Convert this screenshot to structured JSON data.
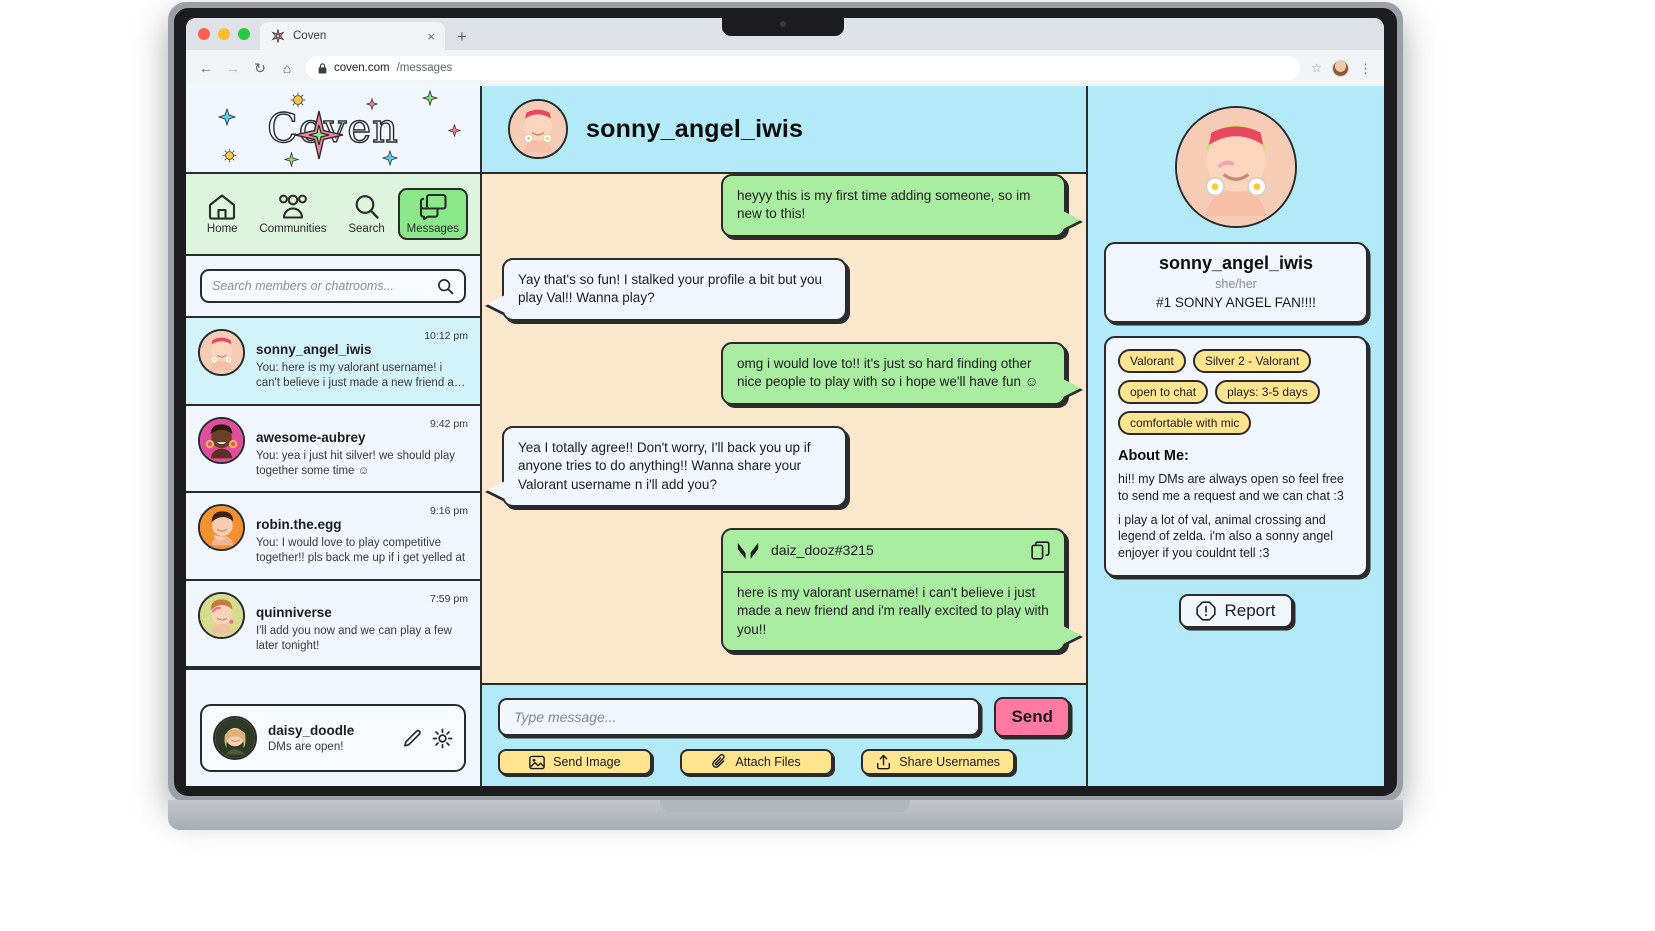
{
  "browser": {
    "tab": {
      "title": "Coven",
      "favicon": "star-sparkle-icon",
      "close": "×"
    },
    "newtab_label": "+",
    "nav": {
      "back": "←",
      "forward": "→",
      "reload": "↻",
      "home": "⌂"
    },
    "url": {
      "lock": "🔒",
      "host": "coven.com",
      "path": "/messages"
    },
    "actions": {
      "star": "☆",
      "menu": "⋮"
    }
  },
  "sidebar": {
    "logo": "Coven",
    "nav": [
      {
        "label": "Home",
        "icon": "home-icon",
        "active": false
      },
      {
        "label": "Communities",
        "icon": "people-group-icon",
        "active": false
      },
      {
        "label": "Search",
        "icon": "magnifier-icon",
        "active": false
      },
      {
        "label": "Messages",
        "icon": "chat-bubbles-icon",
        "active": true
      }
    ],
    "search": {
      "placeholder": "Search members or chatrooms...",
      "value": "",
      "icon": "search-icon"
    },
    "conversations": [
      {
        "name": "sonny_angel_iwis",
        "time": "10:12 pm",
        "preview": "You: here is my valorant username! i can't believe i just made a new friend and i'm...",
        "active": true
      },
      {
        "name": "awesome-aubrey",
        "time": "9:42 pm",
        "preview": "You: yea i just hit silver! we should play together some time ☺",
        "active": false
      },
      {
        "name": "robin.the.egg",
        "time": "9:16 pm",
        "preview": "You: I would love to play competitive together!! pls back me up if i get yelled at",
        "active": false
      },
      {
        "name": "quinniverse",
        "time": "7:59 pm",
        "preview": "I'll add you now and we can play a few later tonight!",
        "active": false
      }
    ],
    "me": {
      "name": "daisy_doodle",
      "status": "DMs are open!",
      "edit_icon": "pencil-icon",
      "settings_icon": "gear-icon"
    }
  },
  "chat": {
    "header_name": "sonny_angel_iwis",
    "messages": [
      {
        "side": "out",
        "text": "heyyy this is my first time adding someone, so im new to this!",
        "type": "text"
      },
      {
        "side": "in",
        "text": "Yay that's so fun! I stalked your profile a bit but you play Val!! Wanna play?",
        "type": "text"
      },
      {
        "side": "out",
        "text": "omg i would love to!! it's just so hard finding other nice people to play with so i hope we'll have fun ☺",
        "type": "text"
      },
      {
        "side": "in",
        "text": "Yea I totally agree!! Don't worry, I'll back you up if anyone tries to do anything!! Wanna share your Valorant username n i'll add you?",
        "type": "text"
      },
      {
        "side": "out",
        "type": "username-card",
        "game_icon": "valorant-icon",
        "username": "daiz_dooz#3215",
        "copy_icon": "copy-icon",
        "text": "here is my valorant username! i can't believe i just made a new friend and i'm really excited to play with you!!"
      }
    ],
    "composer": {
      "placeholder": "Type message...",
      "value": "",
      "send_label": "Send",
      "tools": [
        {
          "label": "Send Image",
          "icon": "image-icon"
        },
        {
          "label": "Attach Files",
          "icon": "paperclip-icon"
        },
        {
          "label": "Share Usernames",
          "icon": "share-upload-icon"
        }
      ]
    }
  },
  "profile": {
    "avatar": "profile-photo",
    "name": "sonny_angel_iwis",
    "pronouns": "she/her",
    "tagline": "#1 SONNY ANGEL FAN!!!!",
    "chips": [
      "Valorant",
      "Silver 2 - Valorant",
      "open to chat",
      "plays: 3-5 days",
      "comfortable with mic"
    ],
    "about_heading": "About Me:",
    "about_p1": "hi!! my DMs are always open so feel free to send me a request and we can chat :3",
    "about_p2": "i play a lot of val, animal crossing and legend of zelda. i'm also a sonny angel enjoyer if you couldnt tell :3",
    "report_label": "Report",
    "report_icon": "alert-octagon-icon"
  },
  "colors": {
    "ink": "#2b2b2b",
    "mint": "#a9eda0",
    "cyan": "#b3eaf7",
    "cream": "#fbe8cc",
    "pale": "#f2f6ff",
    "yellow": "#ffe58f",
    "pink": "#ff7aa2",
    "navgreen": "#ddf5dd",
    "activegreen": "#8ae88a"
  }
}
